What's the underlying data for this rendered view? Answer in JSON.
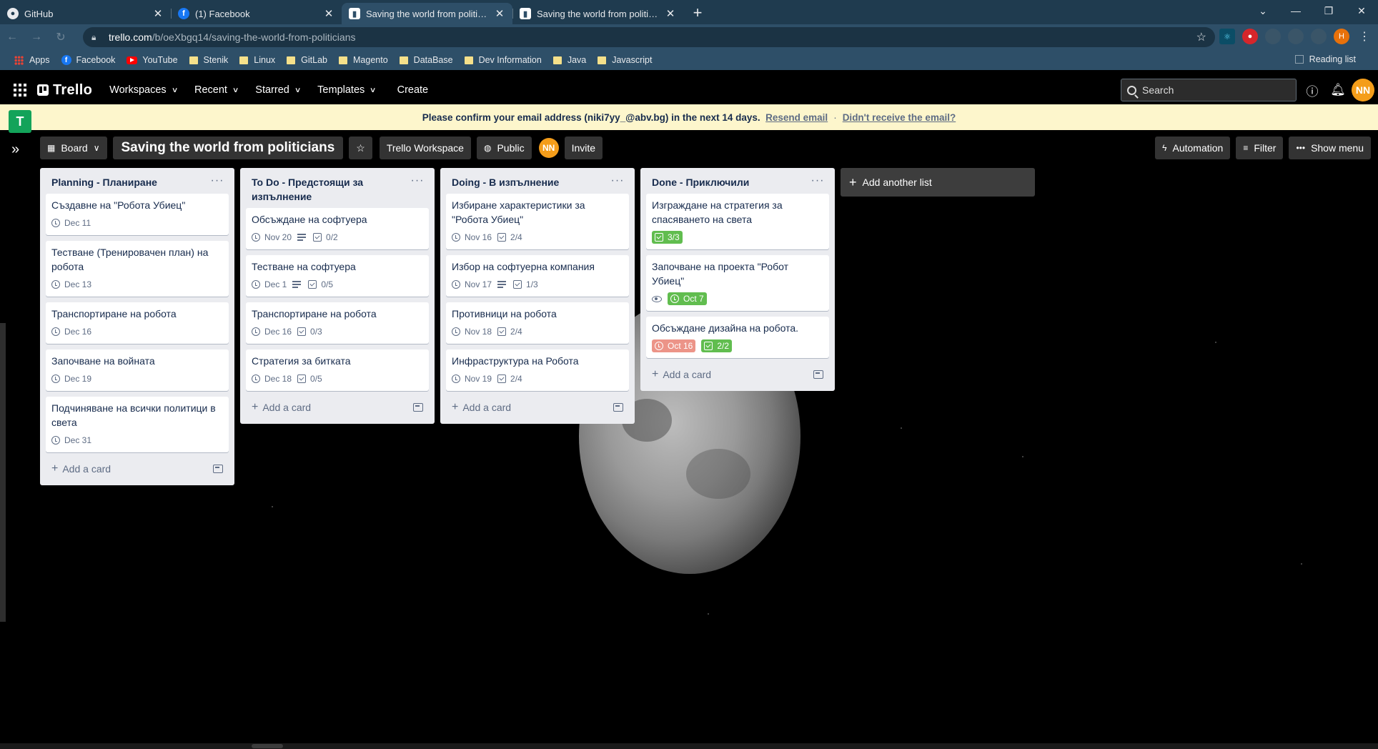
{
  "browser": {
    "tabs": [
      {
        "title": "GitHub",
        "icon": "github-icon"
      },
      {
        "title": "(1) Facebook",
        "icon": "facebook-icon"
      },
      {
        "title": "Saving the world from politicians",
        "icon": "trello-icon"
      },
      {
        "title": "Saving the world from politicians",
        "icon": "trello-icon"
      }
    ],
    "new_tab": "+",
    "url_host": "trello.com",
    "url_path": "/b/oeXbgq14/saving-the-world-from-politicians",
    "profile_initial": "H",
    "bookmarks": [
      "Apps",
      "Facebook",
      "YouTube",
      "Stenik",
      "Linux",
      "GitLab",
      "Magento",
      "DataBase",
      "Dev Information",
      "Java",
      "Javascript"
    ],
    "reading_list": "Reading list"
  },
  "trello": {
    "logo": "Trello",
    "menu": [
      "Workspaces",
      "Recent",
      "Starred",
      "Templates"
    ],
    "create": "Create",
    "search_placeholder": "Search",
    "user_initials": "NN",
    "workspace_tile": "T"
  },
  "banner": {
    "message": "Please confirm your email address (niki7yy_@abv.bg) in the next 14 days.",
    "resend": "Resend email",
    "separator": "·",
    "not_received": "Didn't receive the email?"
  },
  "board": {
    "view": "Board",
    "title": "Saving the world from politicians",
    "workspace": "Trello Workspace",
    "visibility": "Public",
    "member": "NN",
    "invite": "Invite",
    "automation": "Automation",
    "filter": "Filter",
    "show_menu": "Show menu",
    "add_card": "Add a card",
    "add_list": "Add another list",
    "lists": [
      {
        "title": "Planning -  Планиране",
        "cards": [
          {
            "title": "Създавне на \"Робота Убиец\"",
            "due": "Dec 11"
          },
          {
            "title": "Тестване (Тренировачен план) на робота",
            "due": "Dec 13"
          },
          {
            "title": "Транспортиране на робота",
            "due": "Dec 16"
          },
          {
            "title": "Започване на войната",
            "due": "Dec 19"
          },
          {
            "title": "Подчиняване на всички политици в света",
            "due": "Dec 31"
          }
        ]
      },
      {
        "title": "To Do - Предстоящи за изпълнение",
        "cards": [
          {
            "title": "Обсъждане на софтуера",
            "due": "Nov 20",
            "desc": true,
            "checklist": "0/2"
          },
          {
            "title": "Тестване на софтуера",
            "due": "Dec 1",
            "desc": true,
            "checklist": "0/5"
          },
          {
            "title": "Транспортиране на робота",
            "due": "Dec 16",
            "checklist": "0/3"
          },
          {
            "title": "Стратегия за битката",
            "due": "Dec 18",
            "checklist": "0/5"
          }
        ]
      },
      {
        "title": "Doing - В изпълнение",
        "cards": [
          {
            "title": "Избиране характеристики за \"Робота Убиец\"",
            "due": "Nov 16",
            "checklist": "2/4"
          },
          {
            "title": "Избор на софтуерна компания",
            "due": "Nov 17",
            "desc": true,
            "checklist": "1/3"
          },
          {
            "title": "Противници на робота",
            "due": "Nov 18",
            "checklist": "2/4"
          },
          {
            "title": "Инфраструктура на Робота",
            "due": "Nov 19",
            "checklist": "2/4"
          }
        ]
      },
      {
        "title": "Done - Приключили",
        "cards": [
          {
            "title": "Изграждане на стратегия за спасяването на света",
            "checklist": "3/3",
            "checklist_done": true
          },
          {
            "title": "Започване на проекта \"Робот Убиец\"",
            "watch": true,
            "due": "Oct 7",
            "due_state": "complete"
          },
          {
            "title": "Обсъждане дизайна на робота.",
            "due": "Oct 16",
            "due_state": "overdue",
            "checklist": "2/2",
            "checklist_done": true
          }
        ]
      }
    ]
  },
  "colors": {
    "header_bg": "#000000",
    "banner_bg": "#fdf6cc",
    "list_bg": "#ebecf0",
    "badge_green": "#61bd4f",
    "badge_red": "#ec9488",
    "workspace_tile": "#13a35a",
    "avatar": "#f49d1a"
  }
}
